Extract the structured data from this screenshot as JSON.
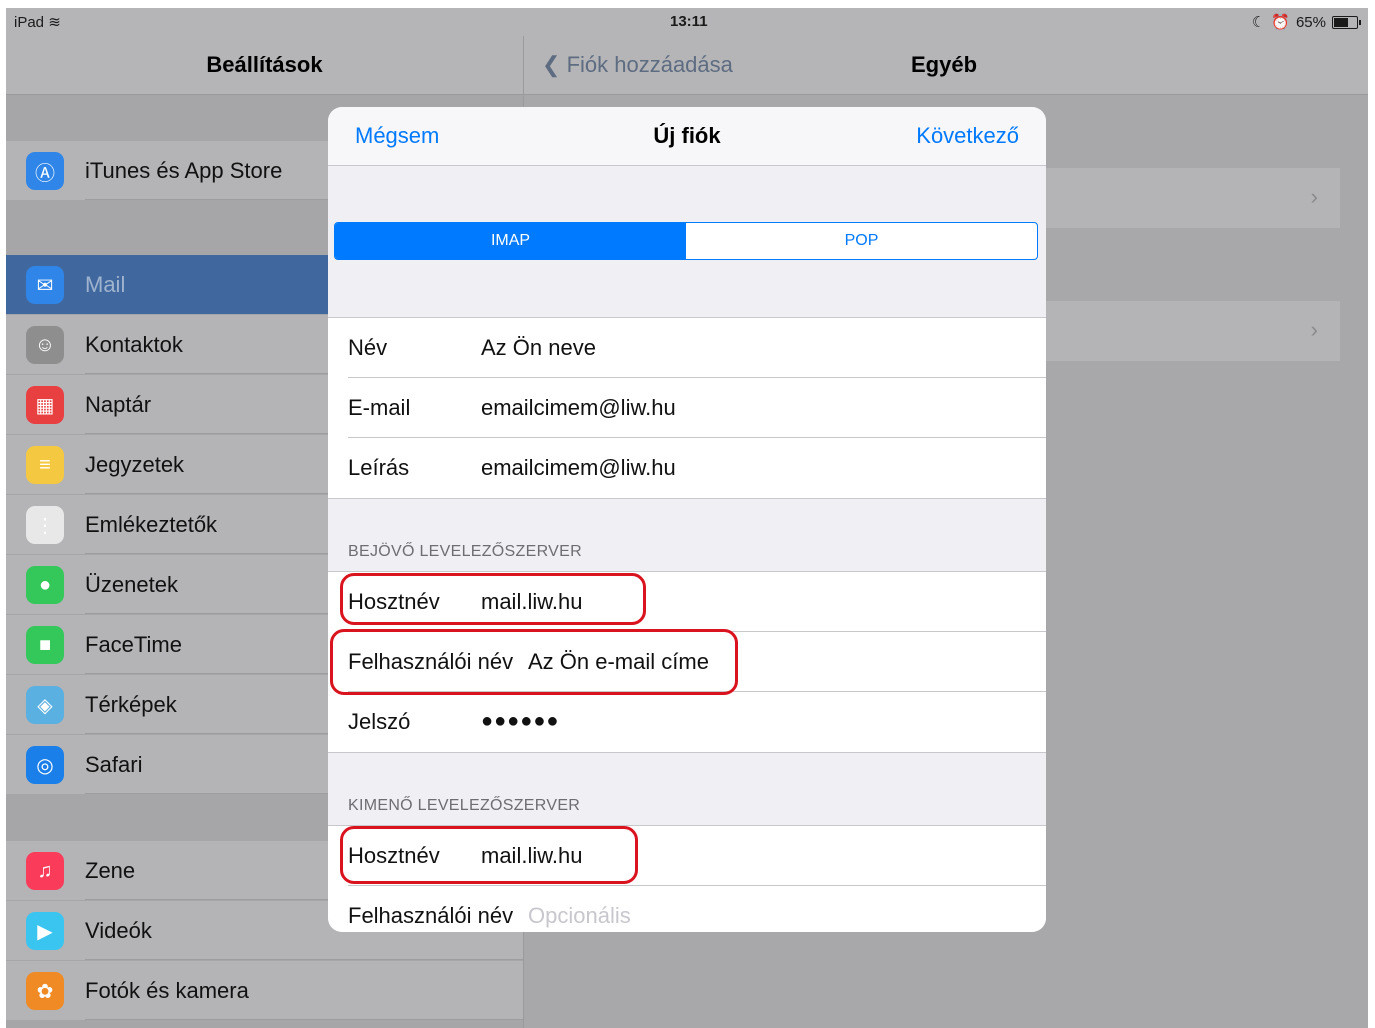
{
  "status_bar": {
    "device": "iPad",
    "wifi_icon": "wifi-icon",
    "time": "13:11",
    "battery": "65%",
    "battery_level": 0.65
  },
  "left_nav": {
    "title": "Beállítások"
  },
  "right_nav": {
    "back_label": "Fiók hozzáadása",
    "title": "Egyéb"
  },
  "sidebar": {
    "items": [
      {
        "label": "iTunes és App Store",
        "icon": "app-store-icon",
        "color": "#2f86e8"
      },
      {
        "label": "Mail",
        "icon": "mail-icon",
        "color": "#2f86e8",
        "selected": true
      },
      {
        "label": "Kontaktok",
        "icon": "contacts-icon",
        "color": "#8e8e8e"
      },
      {
        "label": "Naptár",
        "icon": "calendar-icon",
        "color": "#e84040"
      },
      {
        "label": "Jegyzetek",
        "icon": "notes-icon",
        "color": "#f5c842"
      },
      {
        "label": "Emlékeztetők",
        "icon": "reminders-icon",
        "color": "#e8e8e8"
      },
      {
        "label": "Üzenetek",
        "icon": "messages-icon",
        "color": "#34c759"
      },
      {
        "label": "FaceTime",
        "icon": "facetime-icon",
        "color": "#34c759"
      },
      {
        "label": "Térképek",
        "icon": "maps-icon",
        "color": "#5ab0e0"
      },
      {
        "label": "Safari",
        "icon": "safari-icon",
        "color": "#1a7fe8"
      },
      {
        "label": "Zene",
        "icon": "music-icon",
        "color": "#fa3c5a"
      },
      {
        "label": "Videók",
        "icon": "videos-icon",
        "color": "#3ac4f0"
      },
      {
        "label": "Fotók és kamera",
        "icon": "photos-icon",
        "color": "#f08a24"
      }
    ]
  },
  "modal": {
    "cancel": "Mégsem",
    "title": "Új fiók",
    "next": "Következő",
    "segments": [
      "IMAP",
      "POP"
    ],
    "selected_segment": "IMAP",
    "account": [
      {
        "label": "Név",
        "value": "Az Ön neve"
      },
      {
        "label": "E-mail",
        "value": "emailcimem@liw.hu"
      },
      {
        "label": "Leírás",
        "value": "emailcimem@liw.hu"
      }
    ],
    "incoming": {
      "header": "BEJÖVŐ LEVELEZŐSZERVER",
      "rows": [
        {
          "label": "Hosztnév",
          "value": "mail.liw.hu"
        },
        {
          "label": "Felhasználói név",
          "value": "Az Ön e-mail címe"
        },
        {
          "label": "Jelszó",
          "value": "●●●●●●"
        }
      ]
    },
    "outgoing": {
      "header": "KIMENŐ LEVELEZŐSZERVER",
      "rows": [
        {
          "label": "Hosztnév",
          "value": "mail.liw.hu"
        },
        {
          "label": "Felhasználói név",
          "placeholder": "Opcionális"
        }
      ]
    },
    "highlight_color": "#d9141f"
  }
}
